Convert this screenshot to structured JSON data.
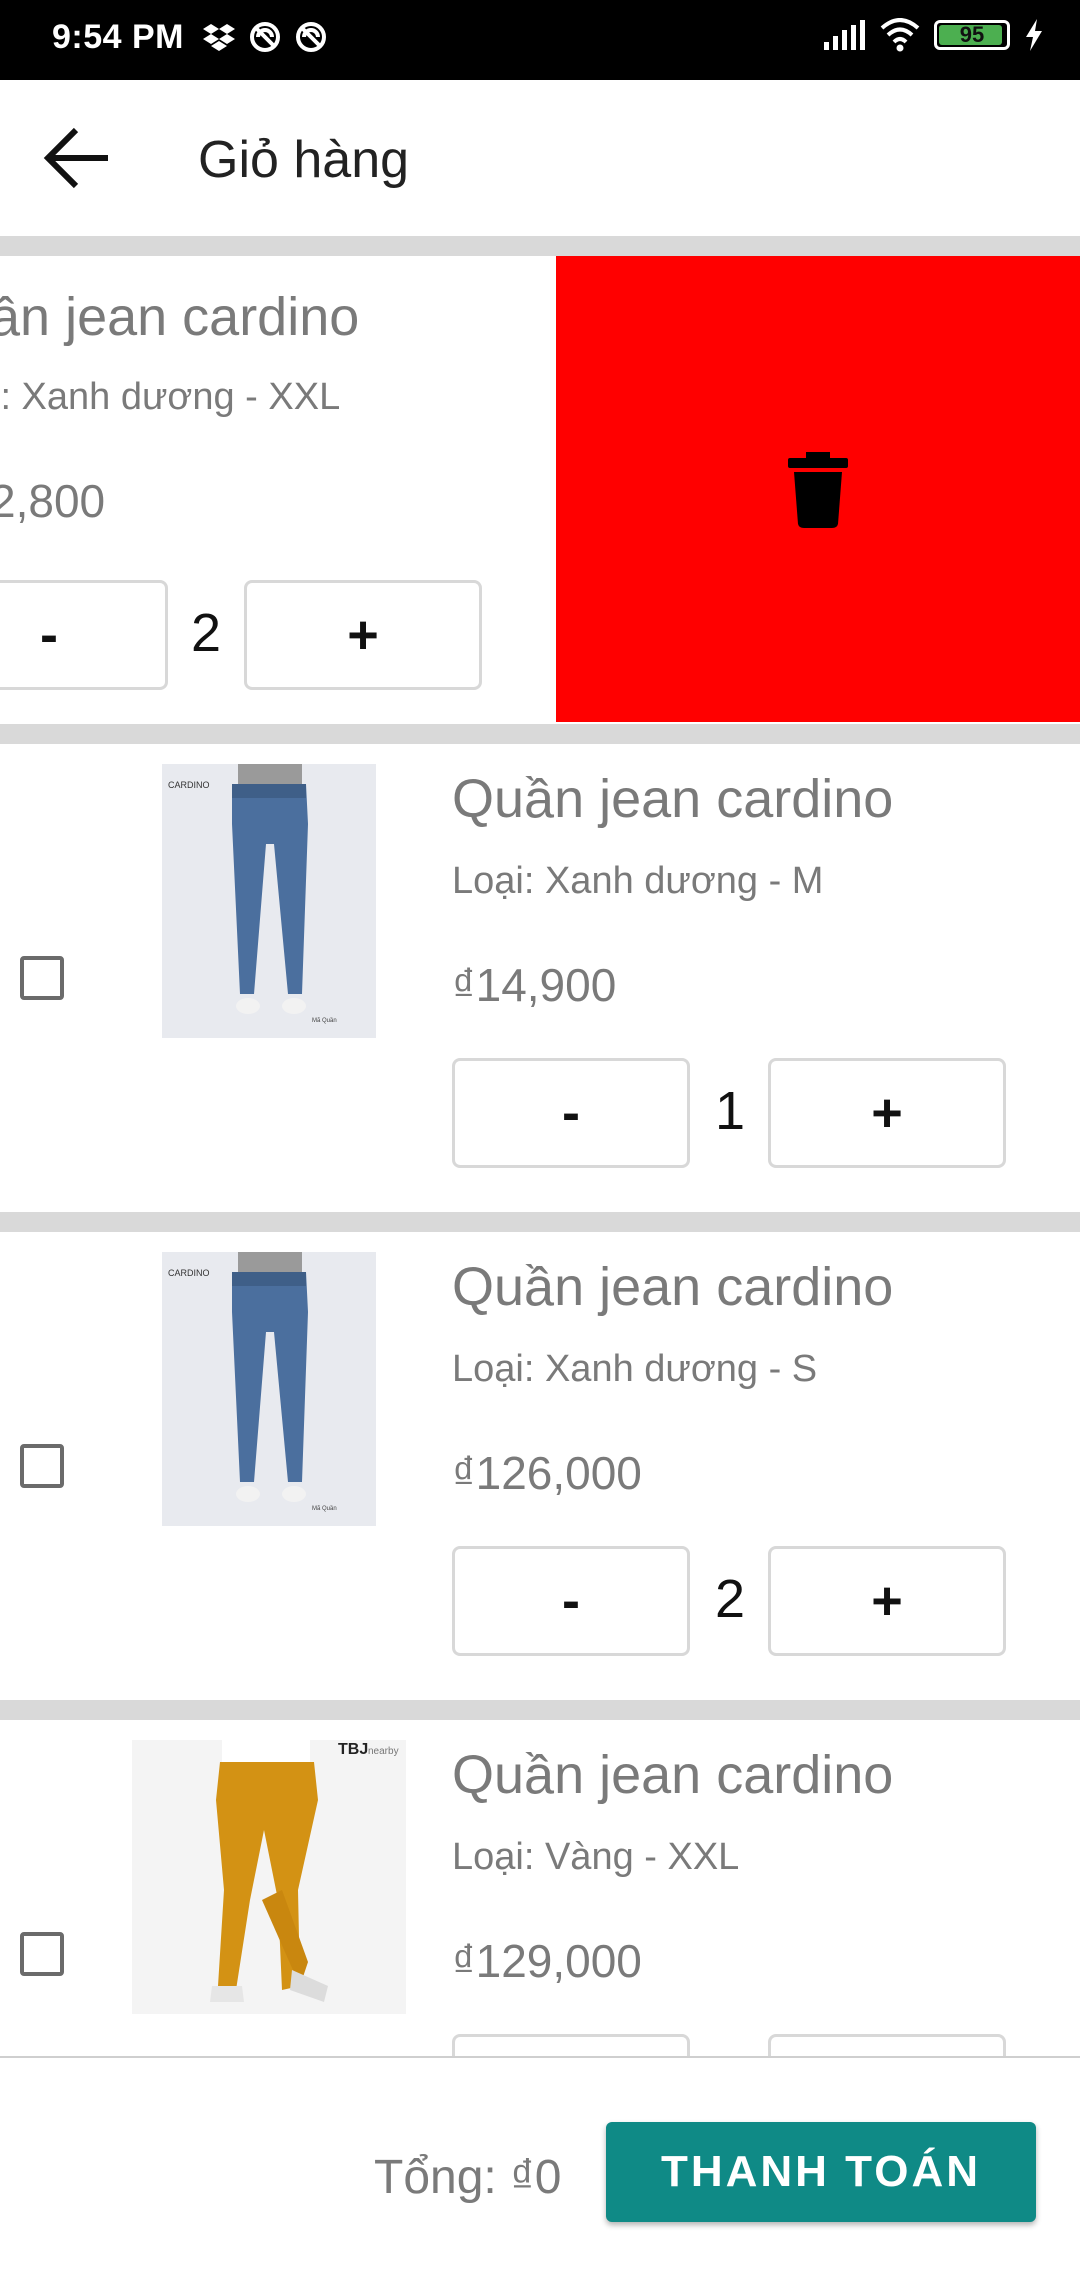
{
  "status_bar": {
    "time": "9:54 PM",
    "battery": "95",
    "icons": [
      "dropbox-icon",
      "sync-icon",
      "sync-icon",
      "signal-icon",
      "wifi-icon",
      "battery-icon",
      "charging-icon"
    ]
  },
  "appbar": {
    "title": "Giỏ hàng"
  },
  "colors": {
    "accent": "#0f8a86",
    "delete": "#ff0000",
    "divider": "#d9d9d9"
  },
  "cart": {
    "items": [
      {
        "name": "ần jean cardino",
        "variant": "i: Xanh dương - XXL",
        "price": "2,800",
        "qty": "2",
        "minus": "-",
        "plus": "+",
        "swiped": true
      },
      {
        "name": "Quần jean cardino",
        "variant": "Loại: Xanh dương - M",
        "price": "₫14,900",
        "qty": "1",
        "minus": "-",
        "plus": "+"
      },
      {
        "name": "Quần jean cardino",
        "variant": "Loại: Xanh dương - S",
        "price": "₫126,000",
        "qty": "2",
        "minus": "-",
        "plus": "+"
      },
      {
        "name": "Quần jean cardino",
        "variant": "Loại: Vàng - XXL",
        "price": "₫129,000",
        "qty": "",
        "minus": "-",
        "plus": "+",
        "image_text": "TBJ",
        "image_text_small": "nearby"
      }
    ]
  },
  "footer": {
    "total": "Tổng: ₫0",
    "checkout": "THANH TOÁN"
  }
}
